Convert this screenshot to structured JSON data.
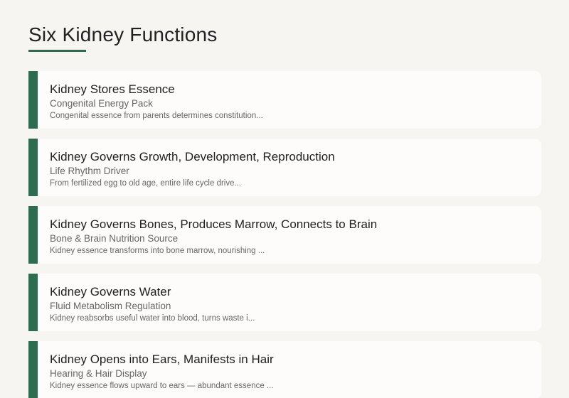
{
  "page": {
    "title": "Six Kidney Functions"
  },
  "colors": {
    "accent": "#2e6b4f",
    "background": "#f6f5f2",
    "card": "#fdfcfa"
  },
  "cards": [
    {
      "title": "Kidney Stores Essence",
      "subtitle": "Congenital Energy Pack",
      "description": "Congenital essence from parents determines constitution..."
    },
    {
      "title": "Kidney Governs Growth, Development, Reproduction",
      "subtitle": "Life Rhythm Driver",
      "description": "From fertilized egg to old age, entire life cycle drive..."
    },
    {
      "title": "Kidney Governs Bones, Produces Marrow, Connects to Brain",
      "subtitle": "Bone & Brain Nutrition Source",
      "description": "Kidney essence transforms into bone marrow, nourishing ..."
    },
    {
      "title": "Kidney Governs Water",
      "subtitle": "Fluid Metabolism Regulation",
      "description": "Kidney reabsorbs useful water into blood, turns waste i..."
    },
    {
      "title": "Kidney Opens into Ears, Manifests in Hair",
      "subtitle": "Hearing & Hair Display",
      "description": "Kidney essence flows upward to ears — abundant essence ..."
    }
  ]
}
